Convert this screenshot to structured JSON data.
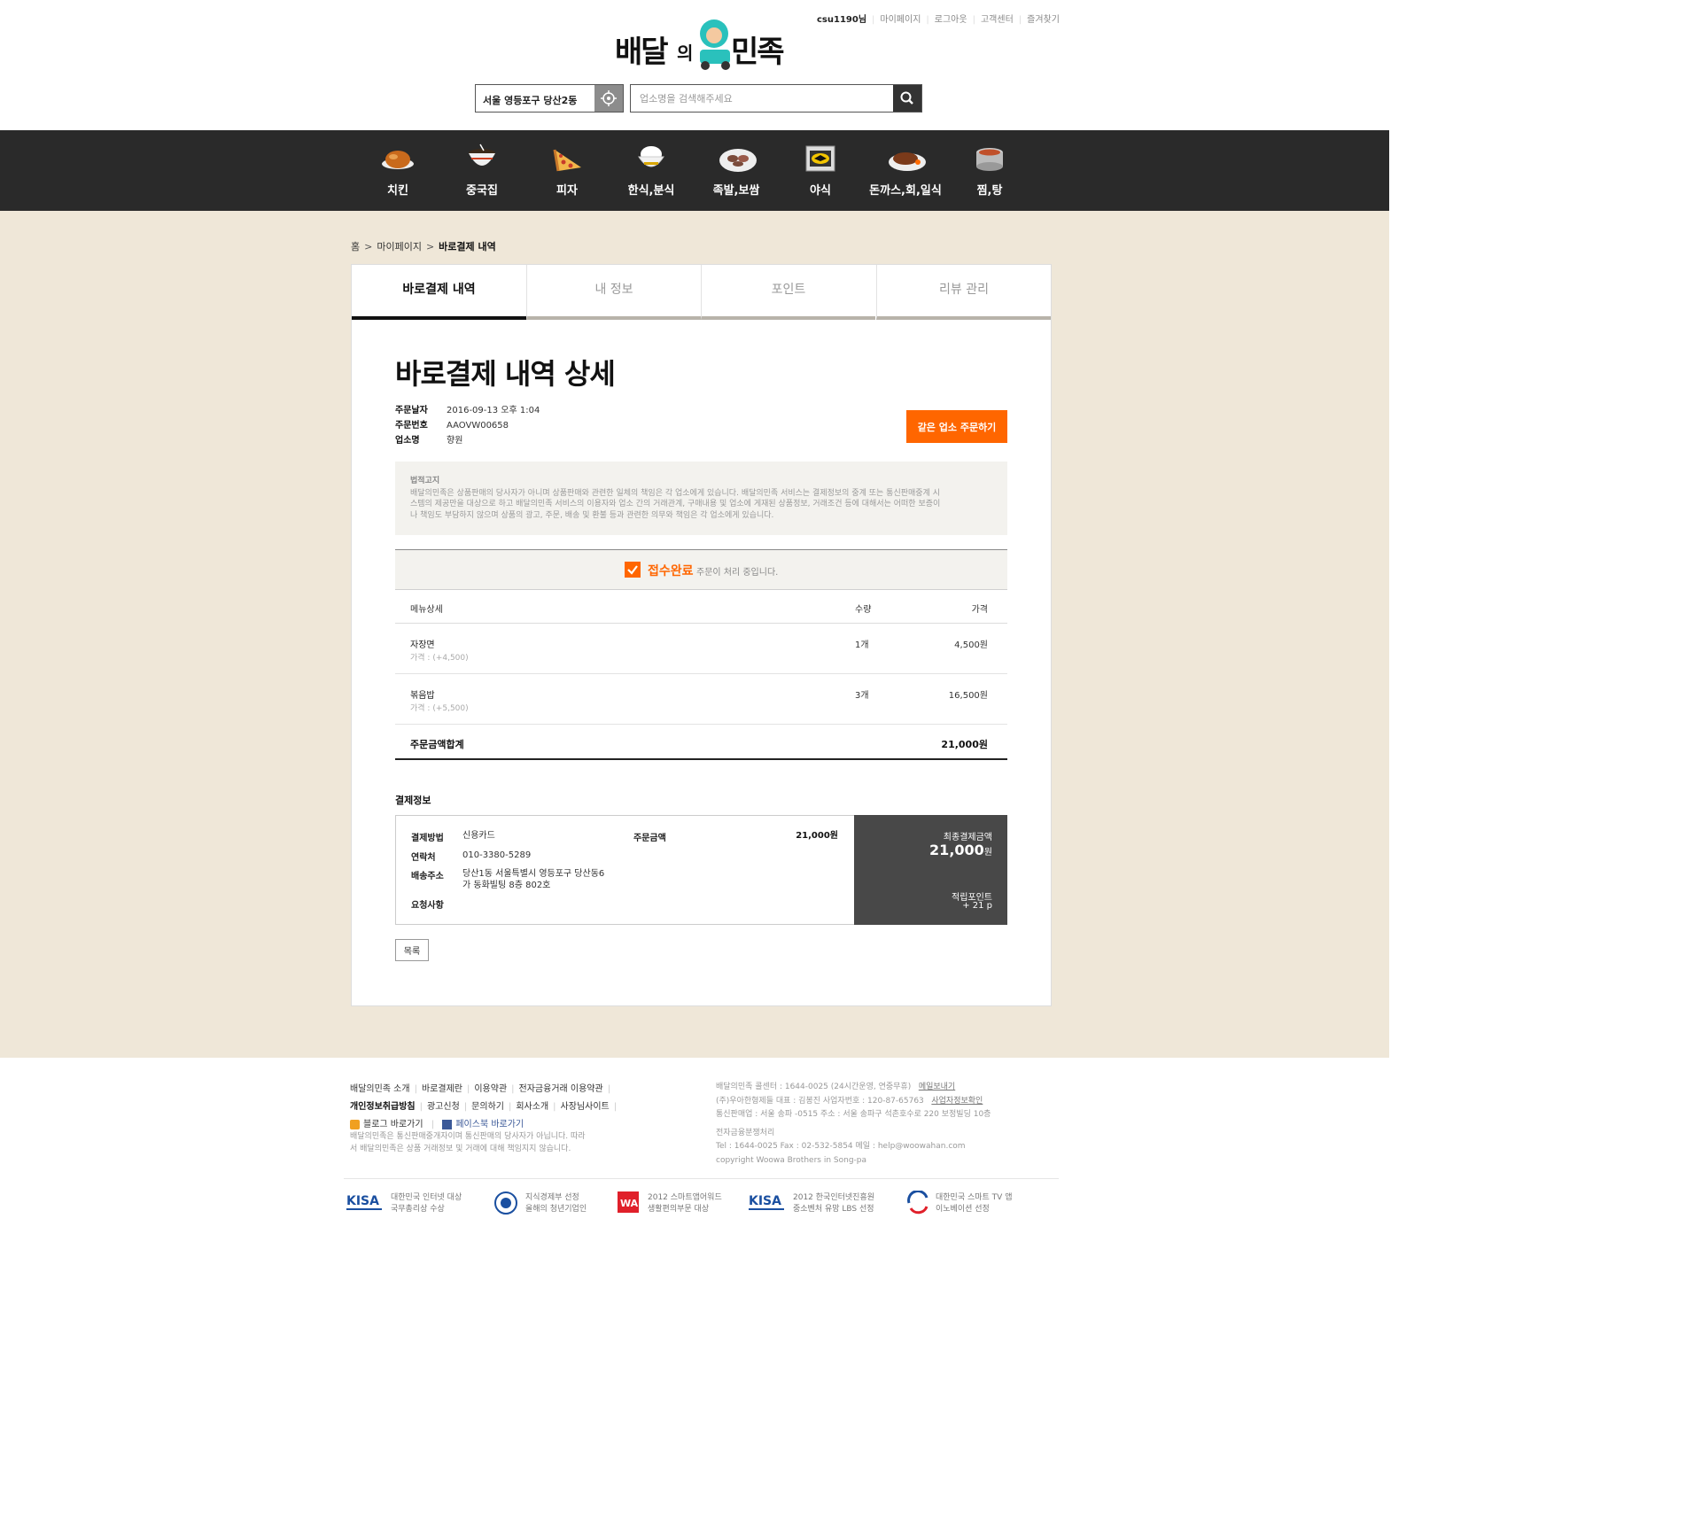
{
  "header": {
    "user": "csu1190님",
    "links": [
      "마이페이지",
      "로그아웃",
      "고객센터",
      "즐겨찾기"
    ],
    "logo_alt": "배달의민족",
    "location": "서울 영등포구 당산2동",
    "search_placeholder": "업소명을 검색해주세요"
  },
  "categories": [
    {
      "label": "치킨",
      "icon": "chicken-icon"
    },
    {
      "label": "중국집",
      "icon": "noodle-bowl-icon"
    },
    {
      "label": "피자",
      "icon": "pizza-icon"
    },
    {
      "label": "한식,분식",
      "icon": "rice-bowl-icon"
    },
    {
      "label": "족발,보쌈",
      "icon": "pork-platter-icon"
    },
    {
      "label": "야식",
      "icon": "night-icon"
    },
    {
      "label": "돈까스,회,일식",
      "icon": "cutlet-icon"
    },
    {
      "label": "찜,탕",
      "icon": "pot-icon"
    }
  ],
  "breadcrumb": {
    "home": "홈",
    "mypage": "마이페이지",
    "current": "바로결제 내역"
  },
  "tabs": [
    "바로결제 내역",
    "내 정보",
    "포인트",
    "리뷰 관리"
  ],
  "detail": {
    "title": "바로결제 내역 상세",
    "order_date_label": "주문날자",
    "order_date": "2016-09-13 오후 1:04",
    "order_no_label": "주문번호",
    "order_no": "AAOVW00658",
    "store_label": "업소명",
    "store": "향원",
    "reorder_button": "같은 업소 주문하기"
  },
  "legal": {
    "title": "법적고지",
    "line1": "배달의민족은 상품판매의 당사자가 아니며 상품판매와 관련한 일체의 책임은 각 업소에게 있습니다. 배달의민족 서비스는 결제정보의 중계 또는 통신판매중계 시",
    "line2": "스템의 제공만을 대상으로 하고 배달의민족 서비스의 이용자와 업소 간의 거래관계, 구매내용 및 업소에 게재된 상품정보, 거래조건 등에 대해서는 어떠한 보증이",
    "line3": "나 책임도 부담하지 않으며 상품의 광고, 주문, 배송 및 환불 등과 관련한 의무와 책임은 각 업소에게 있습니다."
  },
  "status": {
    "title": "접수완료",
    "desc": "주문이 처리 중입니다."
  },
  "menu": {
    "headers": {
      "name": "메뉴상세",
      "qty": "수량",
      "price": "가격"
    },
    "items": [
      {
        "name": "자장면",
        "unit_price": "가격 : (+4,500)",
        "qty": "1개",
        "price": "4,500원"
      },
      {
        "name": "볶음밥",
        "unit_price": "가격 : (+5,500)",
        "qty": "3개",
        "price": "16,500원"
      }
    ],
    "total_label": "주문금액합계",
    "total": "21,000원"
  },
  "payment": {
    "title": "결제정보",
    "method_label": "결제방법",
    "method": "신용카드",
    "contact_label": "연락처",
    "contact": "010-3380-5289",
    "address_label": "배송주소",
    "address_line1": "당산1동 서울특별시 영등포구 당산동6",
    "address_line2": "가 동화빌팅 8층 802호",
    "request_label": "요청사항",
    "order_amount_label": "주문금액",
    "order_amount": "21,000원",
    "final_label": "최종결제금액",
    "final_amount": "21,000",
    "final_unit": "원",
    "points_label": "적립포인트",
    "points": "+ 21 p"
  },
  "list_button": "목록",
  "footer": {
    "links_row1": [
      "배달의민족 소개",
      "바로결제란",
      "이용약관",
      "전자금융거래 이용약관"
    ],
    "links_row2": [
      "개인정보취급방침",
      "광고신청",
      "문의하기",
      "회사소개",
      "사장님사이트"
    ],
    "blog": "블로그 바로가기",
    "facebook": "페이스북 바로가기",
    "desc1": "배달의민족은 통신판매중개자이며 통신판매의 당사자가 아닙니다. 따라",
    "desc2": "서 배달의민족은 상품 거래정보 및 거래에 대해 책임지지 않습니다.",
    "company1": "배달의민족 콜센터 : 1644-0025 (24시간운영, 연중무휴)",
    "mail_link": "메일보내기",
    "company2": "(주)우아한형제들 대표 : 김봉진   사업자번호 : 120-87-65763",
    "biz_link": "사업자정보확인",
    "company3": "통신판매업 : 서울 송파 -0515 주소 : 서울 송파구 석촌호수로 220 보정빌딩 10층",
    "company4": "전자금융분쟁처리",
    "company5": "Tel : 1644-0025   Fax : 02-532-5854   메일 : help@woowahan.com",
    "company6": "copyright Woowa Brothers in Song-pa",
    "awards": [
      {
        "logo": "KISA",
        "line1": "대한민국 인터넷 대상",
        "line2": "국무총리상 수상"
      },
      {
        "logo": "",
        "line1": "지식경제부 선정",
        "line2": "올해의 청년기업인"
      },
      {
        "logo": "WA",
        "line1": "2012 스마트앱어워드",
        "line2": "생활편의부문 대상"
      },
      {
        "logo": "KISA",
        "line1": "2012 한국인터넷진흥원",
        "line2": "중소벤처 유망 LBS 선정"
      },
      {
        "logo": "",
        "line1": "대한민국 스마트 TV 앱",
        "line2": "이노베이션 선정"
      }
    ]
  },
  "colors": {
    "accent": "#ff6600",
    "nav_bg": "#2a2a2a",
    "page_bg": "#efe7d8",
    "dark_box": "#484848"
  }
}
